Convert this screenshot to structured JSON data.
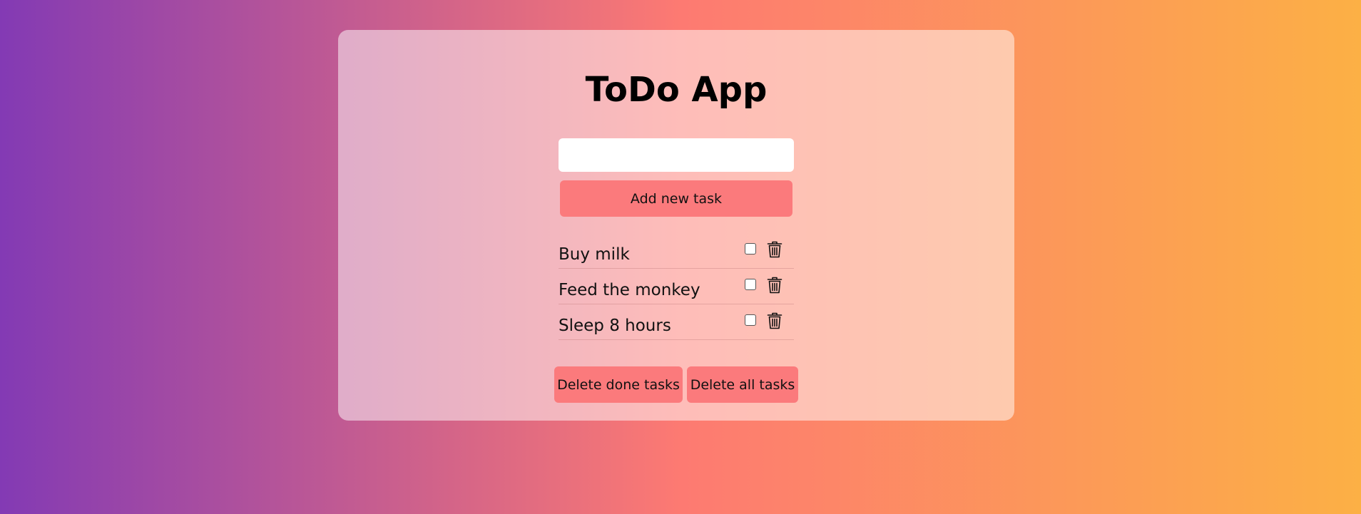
{
  "app": {
    "title": "ToDo App"
  },
  "input": {
    "value": "",
    "placeholder": ""
  },
  "buttons": {
    "add_label": "Add new task",
    "delete_done_label": "Delete done tasks",
    "delete_all_label": "Delete all tasks"
  },
  "tasks": [
    {
      "text": "Buy milk",
      "done": false,
      "delete_icon": "trash-icon"
    },
    {
      "text": "Feed the monkey",
      "done": false,
      "delete_icon": "trash-icon"
    },
    {
      "text": "Sleep 8 hours",
      "done": false,
      "delete_icon": "trash-icon"
    }
  ],
  "colors": {
    "background_gradient": [
      "#833ab4",
      "#fd7a72",
      "#fcb045"
    ],
    "button": "#fb7a7c",
    "card": "rgba(255,255,255,0.5)"
  }
}
